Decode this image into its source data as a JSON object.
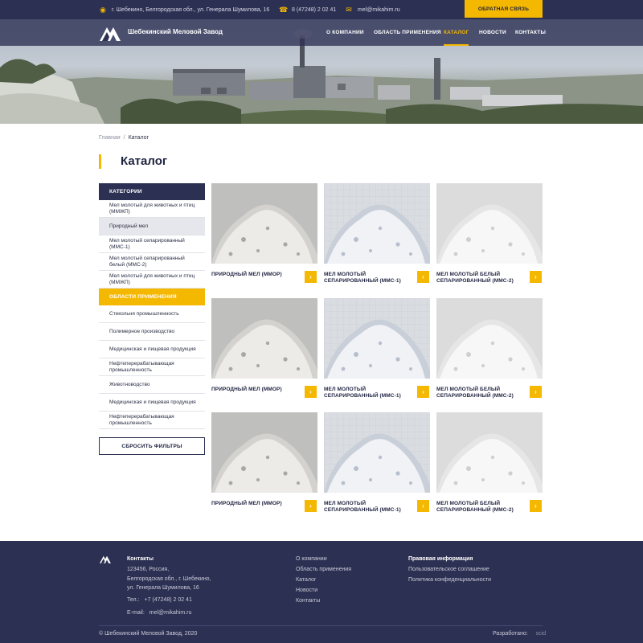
{
  "topbar": {
    "address": "г. Шебекино, Белгородская обл., ул. Генерала Шумилова, 16",
    "phone": "8 (47248) 2 02 41",
    "email": "mel@mikahim.ru",
    "cta": "ОБРАТНАЯ СВЯЗЬ",
    "icons": [
      "map-pin-icon",
      "phone-icon",
      "mail-icon"
    ]
  },
  "header": {
    "logo_text": "Шебекинский Меловой Завод",
    "nav": [
      {
        "label": "О КОМПАНИИ",
        "active": false
      },
      {
        "label": "ОБЛАСТЬ ПРИМЕНЕНИЯ",
        "active": false
      },
      {
        "label": "КАТАЛОГ",
        "active": true
      },
      {
        "label": "НОВОСТИ",
        "active": false
      },
      {
        "label": "КОНТАКТЫ",
        "active": false
      }
    ]
  },
  "breadcrumb": {
    "home": "Главная",
    "sep": "/",
    "current": "Каталог"
  },
  "page_title": "Каталог",
  "sidebar": {
    "categories_title": "КАТЕГОРИИ",
    "categories": [
      {
        "label": "Мел молотый для животных и птиц (ММЖП)",
        "selected": false
      },
      {
        "label": "Природный мел",
        "selected": true
      },
      {
        "label": "Мел молотый сепарированный (ММС-1)",
        "selected": false
      },
      {
        "label": "Мел молотый сепарированный белый (ММС-2)",
        "selected": false
      },
      {
        "label": "Мел молотый для животных и птиц (ММЖП)",
        "selected": false
      }
    ],
    "areas_title": "ОБЛАСТИ ПРИМЕНЕНИЯ",
    "areas": [
      "Стекольня промышленность",
      "Полимерное производство",
      "Медицинская и пищевая продукция",
      "Нефтеперерабатывающая промышленность",
      "Животноводство",
      "Медицинская и пищевая продукция",
      "Нефтеперерабатывающая промышленность"
    ],
    "reset": "СБРОСИТЬ ФИЛЬТРЫ"
  },
  "products": [
    {
      "name": "ПРИРОДНЫЙ МЕЛ (ММОР)",
      "tone": "grey"
    },
    {
      "name": "МЕЛ МОЛОТЫЙ СЕПАРИРОВАННЫЙ (ММС-1)",
      "tone": "blue"
    },
    {
      "name": "МЕЛ МОЛОТЫЙ БЕЛЫЙ СЕПАРИРОВАННЫЙ (ММС-2)",
      "tone": "white"
    },
    {
      "name": "ПРИРОДНЫЙ МЕЛ (ММОР)",
      "tone": "grey"
    },
    {
      "name": "МЕЛ МОЛОТЫЙ СЕПАРИРОВАННЫЙ (ММС-1)",
      "tone": "blue"
    },
    {
      "name": "МЕЛ МОЛОТЫЙ БЕЛЫЙ СЕПАРИРОВАННЫЙ (ММС-2)",
      "tone": "white"
    },
    {
      "name": "ПРИРОДНЫЙ МЕЛ (ММОР)",
      "tone": "grey"
    },
    {
      "name": "МЕЛ МОЛОТЫЙ СЕПАРИРОВАННЫЙ (ММС-1)",
      "tone": "blue"
    },
    {
      "name": "МЕЛ МОЛОТЫЙ БЕЛЫЙ СЕПАРИРОВАННЫЙ (ММС-2)",
      "tone": "white"
    }
  ],
  "footer": {
    "contacts_title": "Контакты",
    "address_lines": [
      "123456, Россия,",
      "Белгородская обл., г. Шебекино,",
      "ул. Генерала Шумилова, 16"
    ],
    "tel_label": "Тел.:",
    "tel": "+7 (47248) 2 02 41",
    "email_label": "E-mail:",
    "email": "mel@mikahim.ru",
    "links": [
      "О компании",
      "Область применения",
      "Каталог",
      "Новости",
      "Контакты"
    ],
    "legal_title": "Правовая информация",
    "legal_links": [
      "Пользовательское соглашение",
      "Политика конфеденциальности"
    ],
    "copyright": "© Шебекинский Меловой Завод, 2020",
    "dev_label": "Разработано:",
    "dev_name": "scid"
  },
  "colors": {
    "navy": "#2c3052",
    "accent": "#f5b800"
  }
}
